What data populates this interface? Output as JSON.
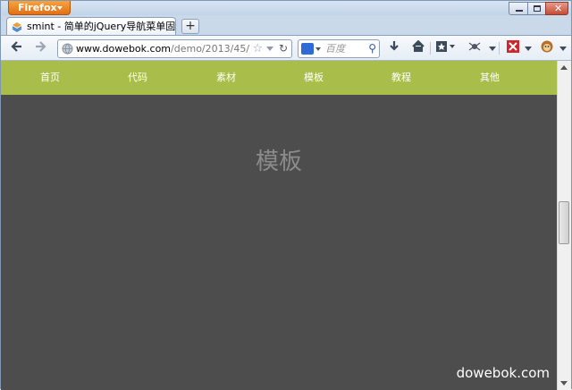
{
  "browser": {
    "app_button_label": "Firefox",
    "tab_title": "smint - 简单的jQuery导航菜单固定插...",
    "new_tab_label": "+",
    "url_domain": "www.dowebok.com",
    "url_path": "/demo/2013/45/",
    "search_placeholder": "百度"
  },
  "page": {
    "menu": [
      {
        "label": "首页"
      },
      {
        "label": "代码"
      },
      {
        "label": "素材"
      },
      {
        "label": "模板"
      },
      {
        "label": "教程"
      },
      {
        "label": "其他"
      }
    ],
    "section_title": "模板",
    "watermark": "dowebok.com"
  },
  "colors": {
    "menu_bg": "#a8bd4a",
    "page_bg": "#4d4d4d",
    "section_title": "#8b8b8b"
  }
}
